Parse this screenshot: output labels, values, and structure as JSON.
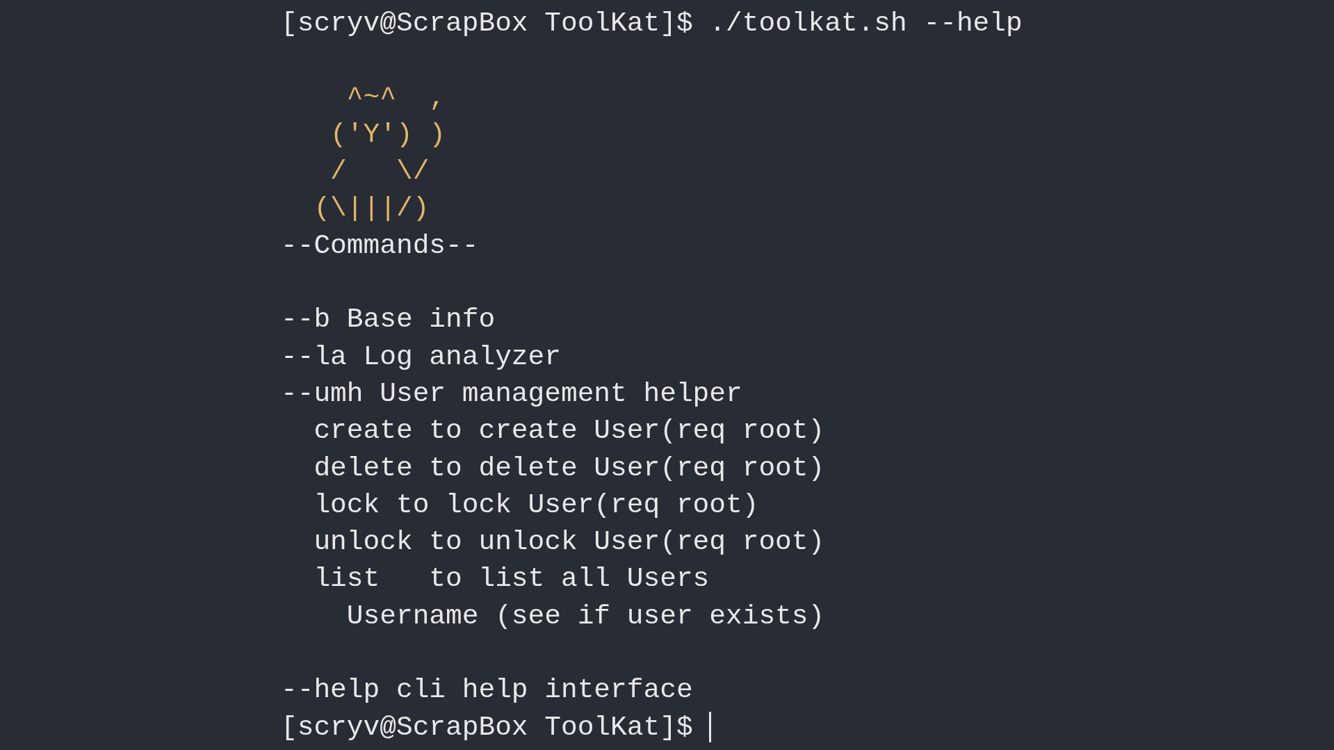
{
  "blocks": [
    {
      "lines": [
        {
          "kind": "prompt",
          "prompt": "[scryv@ScrapBox ToolKat]$",
          "command": "./toolkat.sh --help",
          "cursor": false
        }
      ]
    },
    {
      "lines": [
        {
          "kind": "art",
          "text": "    ^~^  ,"
        },
        {
          "kind": "art",
          "text": "   ('Y') )"
        },
        {
          "kind": "art",
          "text": "   /   \\/"
        },
        {
          "kind": "art",
          "text": "  (\\|||/)"
        },
        {
          "kind": "output",
          "text": "--Commands--"
        }
      ]
    },
    {
      "lines": [
        {
          "kind": "output",
          "text": "--b Base info"
        },
        {
          "kind": "output",
          "text": "--la Log analyzer"
        },
        {
          "kind": "output",
          "text": "--umh User management helper"
        },
        {
          "kind": "output",
          "text": "  create to create User(req root)"
        },
        {
          "kind": "output",
          "text": "  delete to delete User(req root)"
        },
        {
          "kind": "output",
          "text": "  lock to lock User(req root)"
        },
        {
          "kind": "output",
          "text": "  unlock to unlock User(req root)"
        },
        {
          "kind": "output",
          "text": "  list   to list all Users"
        },
        {
          "kind": "output",
          "text": "    Username (see if user exists)"
        }
      ]
    },
    {
      "lines": [
        {
          "kind": "output",
          "text": "--help cli help interface"
        },
        {
          "kind": "prompt",
          "prompt": "[scryv@ScrapBox ToolKat]$",
          "cursor": true
        }
      ]
    }
  ]
}
